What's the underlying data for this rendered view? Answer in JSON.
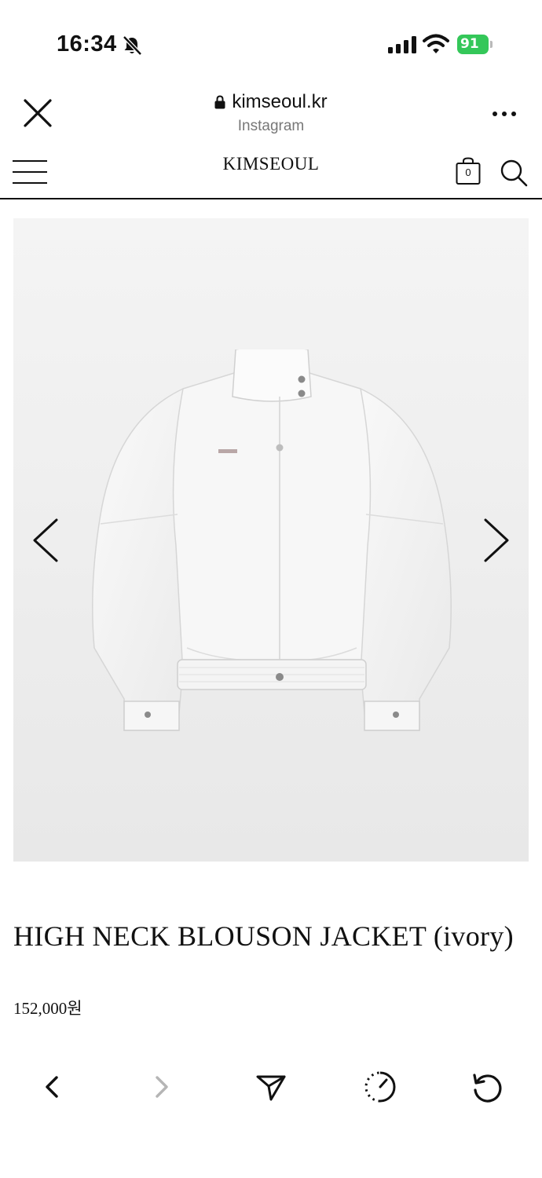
{
  "status_bar": {
    "time": "16:34",
    "battery_level": "91",
    "icons": [
      "bell-slash-icon",
      "cellular-signal-icon",
      "wifi-icon",
      "battery-icon"
    ]
  },
  "browser": {
    "url": "kimseoul.kr",
    "source": "Instagram",
    "icons": [
      "close-icon",
      "lock-icon",
      "more-icon"
    ]
  },
  "site": {
    "logo": "KIMSEOUL",
    "cart_count": "0",
    "icons": [
      "menu-icon",
      "shopping-bag-icon",
      "search-icon"
    ]
  },
  "product": {
    "name": "HIGH NECK BLOUSON JACKET (ivory)",
    "price": "152,000원",
    "image_subject": "ivory-high-neck-blouson-jacket",
    "icons": [
      "chevron-left-icon",
      "chevron-right-icon"
    ]
  },
  "toolbar": {
    "icons": [
      "back-icon",
      "forward-icon",
      "share-icon",
      "history-icon",
      "reload-icon"
    ],
    "forward_enabled": false
  },
  "colors": {
    "battery": "#34c759",
    "image_background": "#eeeeee",
    "text": "#111111",
    "disabled": "#b5b5b5"
  }
}
